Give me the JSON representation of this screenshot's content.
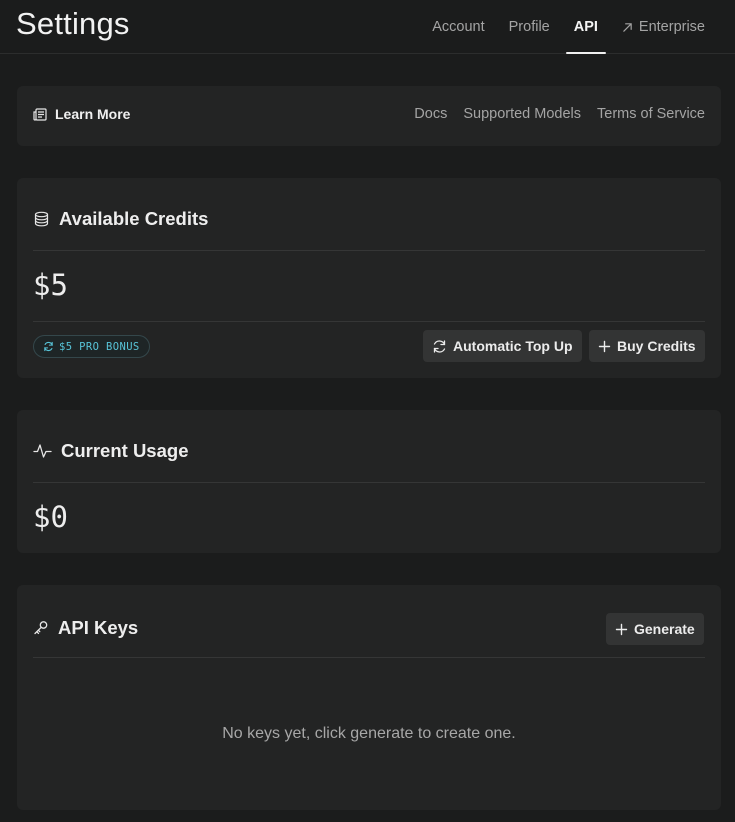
{
  "header": {
    "title": "Settings",
    "tabs": [
      {
        "label": "Account",
        "active": false
      },
      {
        "label": "Profile",
        "active": false
      },
      {
        "label": "API",
        "active": true
      },
      {
        "label": "Enterprise",
        "active": false,
        "icon": "arrow-up-right-icon"
      }
    ]
  },
  "learn_more": {
    "title": "Learn More",
    "icon": "newspaper-icon",
    "links": [
      "Docs",
      "Supported Models",
      "Terms of Service"
    ]
  },
  "credits": {
    "title": "Available Credits",
    "icon": "coins-icon",
    "amount": "$5",
    "bonus_badge": "$5 PRO BONUS",
    "top_up_label": "Automatic Top Up",
    "buy_label": "Buy Credits"
  },
  "usage": {
    "title": "Current Usage",
    "icon": "activity-icon",
    "amount": "$0"
  },
  "api_keys": {
    "title": "API Keys",
    "icon": "key-icon",
    "generate_label": "Generate",
    "empty_message": "No keys yet, click generate to create one."
  },
  "colors": {
    "background": "#1b1c1c",
    "card": "#232424",
    "button": "#333434",
    "accent_cyan": "#58c4d8"
  }
}
